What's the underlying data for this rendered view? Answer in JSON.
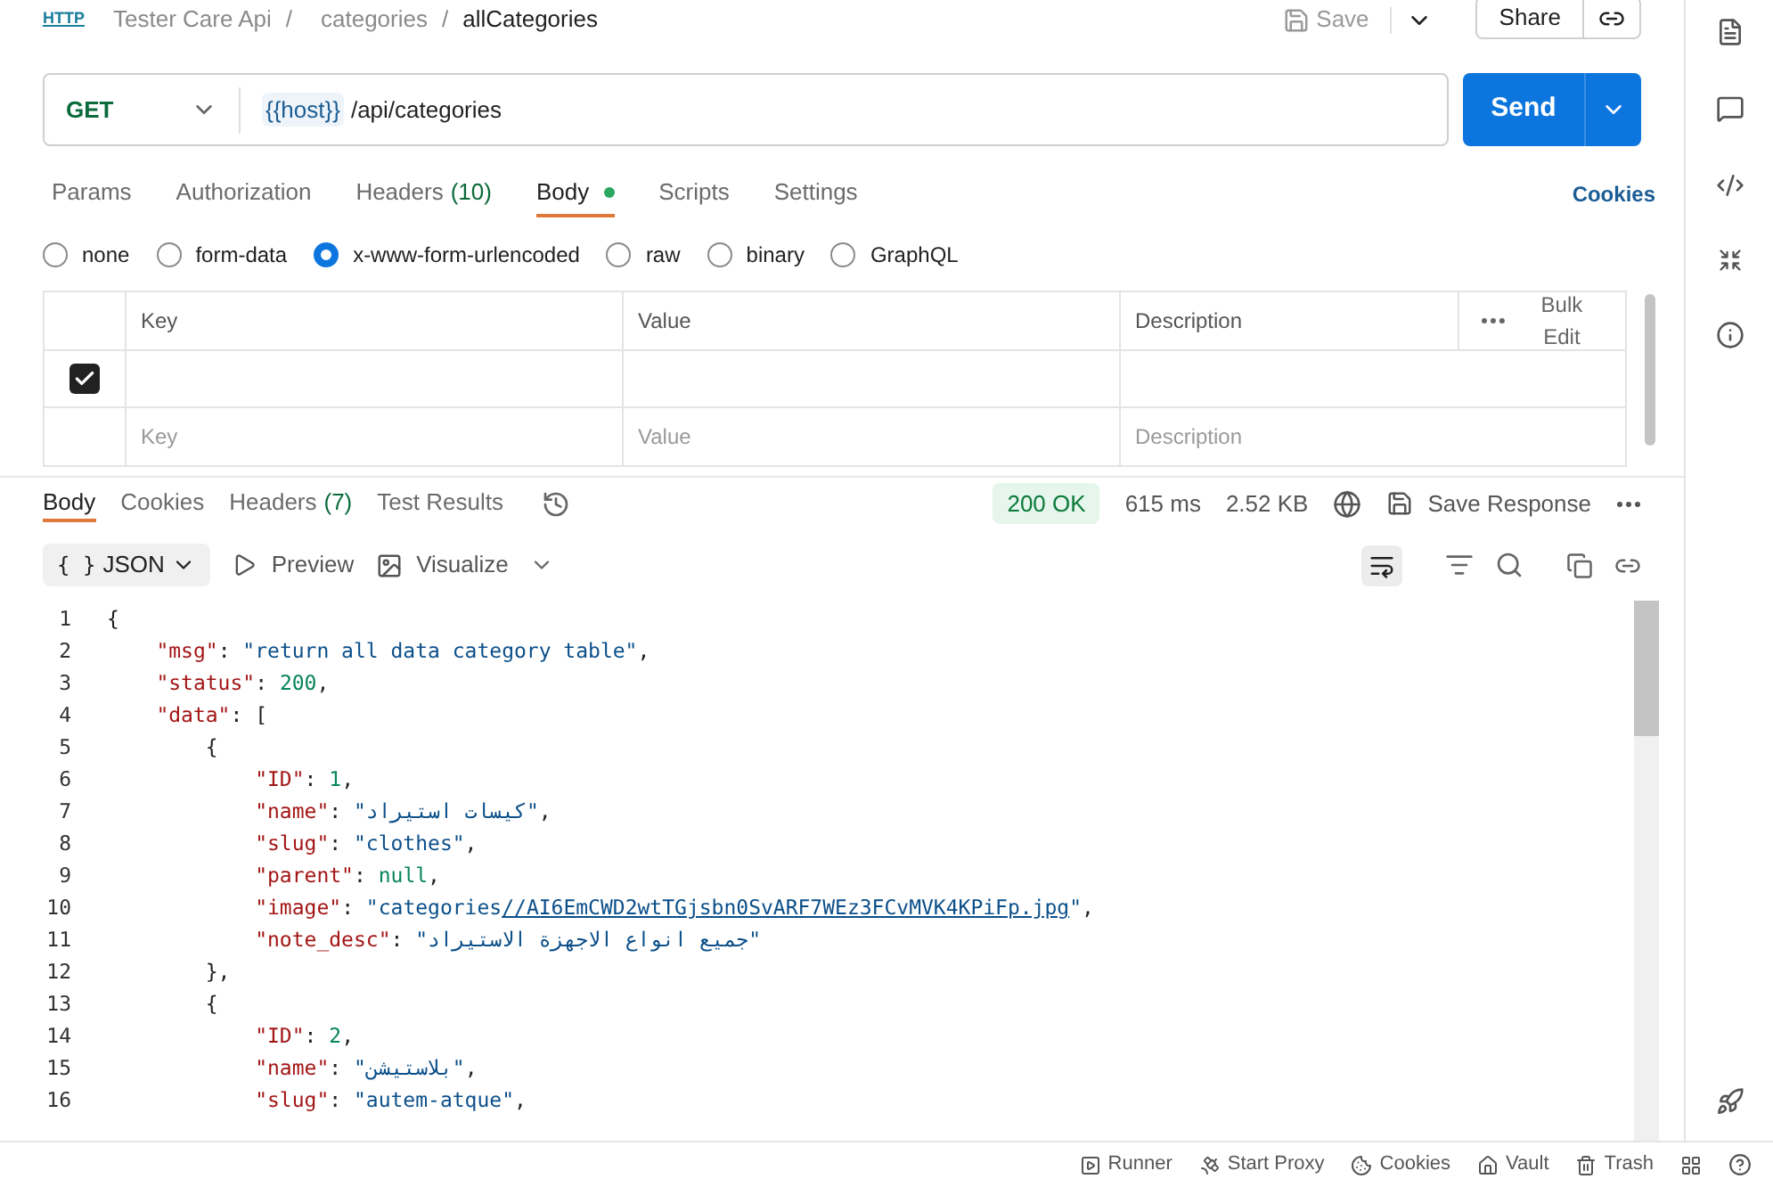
{
  "breadcrumb": {
    "method_badge": "HTTP",
    "parts": [
      {
        "label": "Tester Care Api",
        "separator": "/"
      },
      {
        "label": "categories",
        "separator": "/"
      }
    ],
    "current": "allCategories"
  },
  "header_actions": {
    "save": "Save",
    "share": "Share"
  },
  "request": {
    "method": "GET",
    "host_var": "{{host}}",
    "path": "/api/categories",
    "send": "Send"
  },
  "request_tabs": [
    {
      "label": "Params",
      "selected": false,
      "dot": false
    },
    {
      "label": "Authorization",
      "selected": false,
      "dot": false
    },
    {
      "label": "Headers",
      "count": "(10)",
      "selected": false,
      "dot": false
    },
    {
      "label": "Body",
      "selected": true,
      "dot": true
    },
    {
      "label": "Scripts",
      "selected": false,
      "dot": false
    },
    {
      "label": "Settings",
      "selected": false,
      "dot": false
    }
  ],
  "cookies_link": "Cookies",
  "body_types": [
    {
      "label": "none",
      "selected": false
    },
    {
      "label": "form-data",
      "selected": false
    },
    {
      "label": "x-www-form-urlencoded",
      "selected": true
    },
    {
      "label": "raw",
      "selected": false
    },
    {
      "label": "binary",
      "selected": false
    },
    {
      "label": "GraphQL",
      "selected": false
    }
  ],
  "table": {
    "columns": [
      "Key",
      "Value",
      "Description"
    ],
    "bulk_edit": "Bulk Edit",
    "rows": [
      {
        "checked": true
      },
      {
        "checked": false,
        "placeholders": [
          "Key",
          "Value",
          "Description"
        ]
      }
    ]
  },
  "response_tabs": [
    {
      "label": "Body",
      "selected": true
    },
    {
      "label": "Cookies",
      "selected": false
    },
    {
      "label": "Headers",
      "count": "(7)",
      "selected": false
    },
    {
      "label": "Test Results",
      "selected": false
    }
  ],
  "response_meta": {
    "status": "200 OK",
    "time": "615 ms",
    "size": "2.52 KB",
    "save_response": "Save Response"
  },
  "view_modes": {
    "format_icon": "{ }",
    "format": "JSON",
    "preview": "Preview",
    "visualize": "Visualize"
  },
  "code": [
    {
      "number": "1",
      "tokens": [
        {
          "kind": "punct",
          "text": "{"
        }
      ]
    },
    {
      "number": "2",
      "tokens": [
        {
          "kind": "key",
          "text": "    \"msg\""
        },
        {
          "kind": "punct",
          "text": ": "
        },
        {
          "kind": "string",
          "text": "\"return all data category table\""
        },
        {
          "kind": "punct",
          "text": ","
        }
      ]
    },
    {
      "number": "3",
      "tokens": [
        {
          "kind": "key",
          "text": "    \"status\""
        },
        {
          "kind": "punct",
          "text": ": "
        },
        {
          "kind": "number",
          "text": "200"
        },
        {
          "kind": "punct",
          "text": ","
        }
      ]
    },
    {
      "number": "4",
      "tokens": [
        {
          "kind": "key",
          "text": "    \"data\""
        },
        {
          "kind": "punct",
          "text": ": ["
        }
      ]
    },
    {
      "number": "5",
      "tokens": [
        {
          "kind": "punct",
          "text": "        {"
        }
      ]
    },
    {
      "number": "6",
      "tokens": [
        {
          "kind": "key",
          "text": "            \"ID\""
        },
        {
          "kind": "punct",
          "text": ": "
        },
        {
          "kind": "number",
          "text": "1"
        },
        {
          "kind": "punct",
          "text": ","
        }
      ]
    },
    {
      "number": "7",
      "tokens": [
        {
          "kind": "key",
          "text": "            \"name\""
        },
        {
          "kind": "punct",
          "text": ": "
        },
        {
          "kind": "string",
          "text": "\"كيسات استيراد\""
        },
        {
          "kind": "punct",
          "text": ","
        }
      ]
    },
    {
      "number": "8",
      "tokens": [
        {
          "kind": "key",
          "text": "            \"slug\""
        },
        {
          "kind": "punct",
          "text": ": "
        },
        {
          "kind": "string",
          "text": "\"clothes\""
        },
        {
          "kind": "punct",
          "text": ","
        }
      ]
    },
    {
      "number": "9",
      "tokens": [
        {
          "kind": "key",
          "text": "            \"parent\""
        },
        {
          "kind": "punct",
          "text": ": "
        },
        {
          "kind": "number",
          "text": "null"
        },
        {
          "kind": "punct",
          "text": ","
        }
      ]
    },
    {
      "number": "10",
      "tokens": [
        {
          "kind": "key",
          "text": "            \"image\""
        },
        {
          "kind": "punct",
          "text": ": "
        },
        {
          "kind": "string",
          "text": "\"categories"
        },
        {
          "kind": "link",
          "text": "//AI6EmCWD2wtTGjsbn0SvARF7WEz3FCvMVK4KPiFp.jpg"
        },
        {
          "kind": "string",
          "text": "\""
        },
        {
          "kind": "punct",
          "text": ","
        }
      ]
    },
    {
      "number": "11",
      "tokens": [
        {
          "kind": "key",
          "text": "            \"note_desc\""
        },
        {
          "kind": "punct",
          "text": ": "
        },
        {
          "kind": "string",
          "text": "\"جميع انواع الاجهزة الاستيراد\""
        }
      ]
    },
    {
      "number": "12",
      "tokens": [
        {
          "kind": "punct",
          "text": "        },"
        }
      ]
    },
    {
      "number": "13",
      "tokens": [
        {
          "kind": "punct",
          "text": "        {"
        }
      ]
    },
    {
      "number": "14",
      "tokens": [
        {
          "kind": "key",
          "text": "            \"ID\""
        },
        {
          "kind": "punct",
          "text": ": "
        },
        {
          "kind": "number",
          "text": "2"
        },
        {
          "kind": "punct",
          "text": ","
        }
      ]
    },
    {
      "number": "15",
      "tokens": [
        {
          "kind": "key",
          "text": "            \"name\""
        },
        {
          "kind": "punct",
          "text": ": "
        },
        {
          "kind": "string",
          "text": "\"بلاستيشن\""
        },
        {
          "kind": "punct",
          "text": ","
        }
      ]
    },
    {
      "number": "16",
      "tokens": [
        {
          "kind": "key",
          "text": "            \"slug\""
        },
        {
          "kind": "punct",
          "text": ": "
        },
        {
          "kind": "string",
          "text": "\"autem-atque\""
        },
        {
          "kind": "punct",
          "text": ","
        }
      ]
    }
  ],
  "status_bar": [
    "Runner",
    "Start Proxy",
    "Cookies",
    "Vault",
    "Trash"
  ]
}
